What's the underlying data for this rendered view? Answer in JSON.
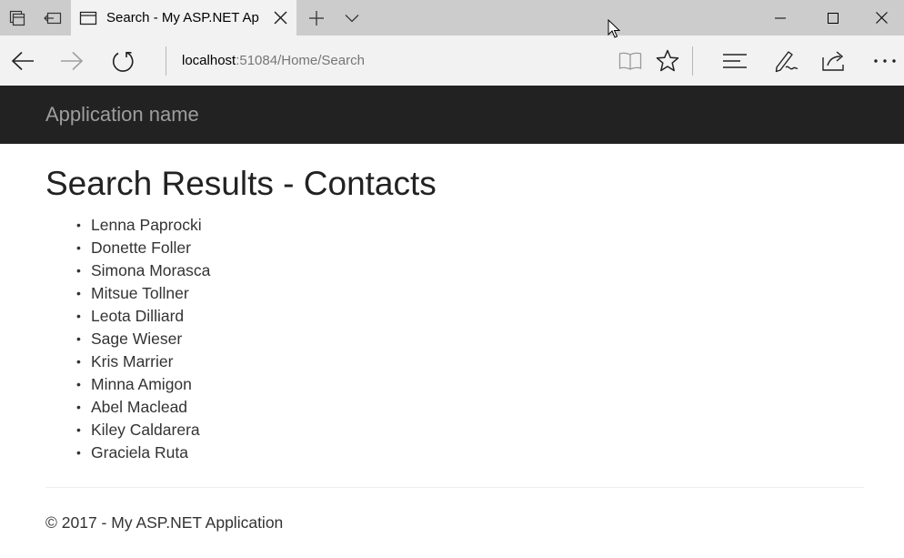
{
  "browser": {
    "tab": {
      "title": "Search - My ASP.NET Ap",
      "icon": "page-icon"
    },
    "titlebar_icons": [
      "tab-set-aside-icon",
      "tab-preview-icon",
      "new-tab-icon",
      "tab-list-chevron-icon"
    ],
    "window_controls": [
      "minimize-icon",
      "maximize-icon",
      "close-icon"
    ],
    "address": {
      "host": "localhost",
      "rest": ":51084/Home/Search"
    },
    "nav_icons": [
      "back-icon",
      "forward-icon",
      "refresh-icon"
    ],
    "tool_icons": [
      "reading-view-icon",
      "favorite-star-icon",
      "hub-icon",
      "web-note-pen-icon",
      "share-icon",
      "more-ellipsis-icon"
    ]
  },
  "site": {
    "brand": "Application name",
    "page_title": "Search Results - Contacts",
    "contacts": [
      "Lenna Paprocki",
      "Donette Foller",
      "Simona Morasca",
      "Mitsue Tollner",
      "Leota Dilliard",
      "Sage Wieser",
      "Kris Marrier",
      "Minna Amigon",
      "Abel Maclead",
      "Kiley Caldarera",
      "Graciela Ruta"
    ],
    "bullet": "•",
    "footer": "© 2017 - My ASP.NET Application"
  },
  "colors": {
    "titlebar_bg": "#cccccc",
    "active_tab_bg": "#f2f2f2",
    "site_header_bg": "#222222",
    "brand_text": "#9d9d9d",
    "url_dim_text": "#767676"
  }
}
